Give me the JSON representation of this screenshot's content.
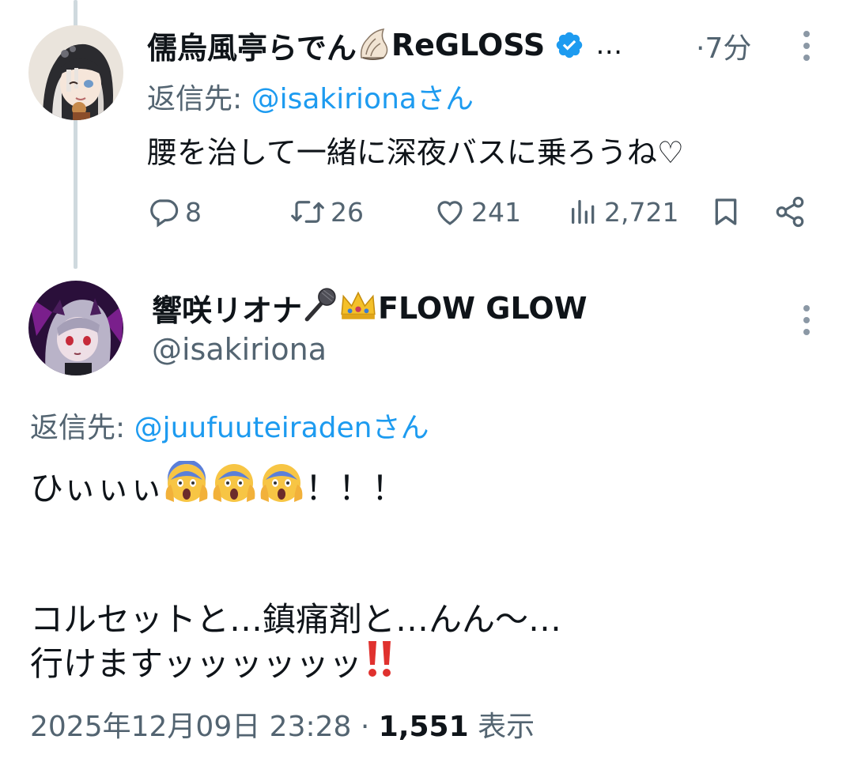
{
  "reply_post": {
    "author_name": "儒烏風亭らでん",
    "author_group": "ReGLOSS",
    "name_truncation": "…",
    "relative_time": "·7分",
    "reply_to_prefix": "返信先: ",
    "reply_to_handle": "@isakirionaさん",
    "text": "腰を治して一緒に深夜バスに乗ろうね♡",
    "stats": {
      "replies": "8",
      "reposts": "26",
      "likes": "241",
      "views": "2,721"
    },
    "icons": [
      "shell-emoji",
      "verified-badge-icon",
      "more-icon",
      "reply-icon",
      "repost-icon",
      "like-icon",
      "views-icon",
      "bookmark-icon",
      "share-icon"
    ]
  },
  "main_post": {
    "author_name_prefix": "響咲リオナ",
    "author_name_suffix": "FLOW GLOW",
    "author_handle": "@isakiriona",
    "reply_to_prefix": "返信先: ",
    "reply_to_handle": "@juufuuteiradenさん",
    "line1_text": "ひぃぃぃ",
    "line1_suffix": "！！！",
    "line2": "コルセットと…鎮痛剤と…んん〜…",
    "line3_text": "行けますッッッッッッ",
    "timestamp": "2025年12月09日 23:28 · ",
    "views_count": "1,551",
    "views_label": " 表示",
    "icons": [
      "microphone-emoji",
      "crown-emoji",
      "scream-emoji",
      "double-exclamation-emoji",
      "more-icon"
    ]
  },
  "colors": {
    "text_primary": "#0f1419",
    "text_secondary": "#536471",
    "link": "#1d9bf0",
    "thread_line": "#cfd9de",
    "verified": "#1d9bf0"
  }
}
